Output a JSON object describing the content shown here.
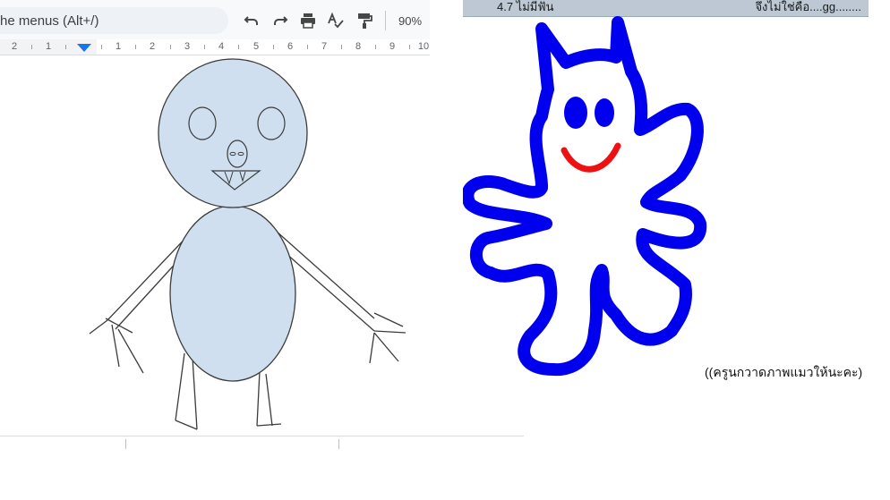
{
  "toolbar": {
    "menu_search_text": "he menus (Alt+/)",
    "undo_icon": "undo-icon",
    "redo_icon": "redo-icon",
    "print_icon": "print-icon",
    "spellcheck_icon": "spellcheck-icon",
    "paint_format_icon": "paint-format-icon",
    "zoom": "90%"
  },
  "ruler": {
    "labels": [
      "2",
      "1",
      "1",
      "2",
      "3",
      "4",
      "5",
      "6",
      "7",
      "8",
      "9",
      "10"
    ]
  },
  "colors": {
    "figure_fill": "#cfdff0",
    "figure_stroke": "#3c3c3c",
    "cat_blue": "#0000ee",
    "cat_smile": "#ee1111",
    "header_bg": "#bdc8d4",
    "toolbar_bg": "#f8f9fa"
  },
  "worksheet": {
    "header_left": "4.7  ไม่มีฟัน",
    "header_right": "จึงไม่ใช่คือ....gg........",
    "caption": "((ครูนกวาดภาพแมวให้นะคะ)"
  }
}
